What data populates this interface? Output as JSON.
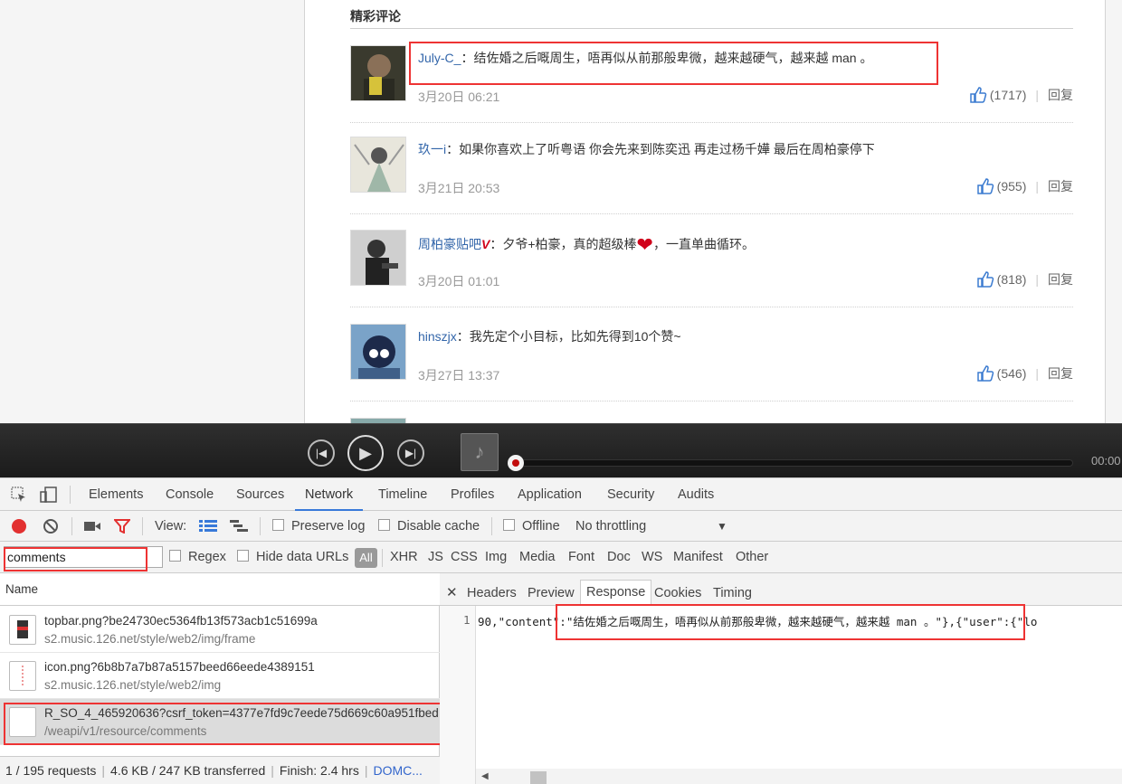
{
  "page": {
    "section_title": "精彩评论",
    "comments": [
      {
        "user": "July-C_",
        "text": "：结佐婚之后嘅周生，唔再似从前那般卑微，越来越硬气，越来越 man 。",
        "time": "3月20日 06:21",
        "likes": "(1717)",
        "reply": "回复"
      },
      {
        "user": "玖一i",
        "text": "：如果你喜欢上了听粤语 你会先来到陈奕迅 再走过杨千嬅 最后在周柏豪停下",
        "time": "3月21日 20:53",
        "likes": "(955)",
        "reply": "回复"
      },
      {
        "user": "周柏豪贴吧",
        "badge": "V",
        "text_before": "：夕爷+柏豪，真的超级棒",
        "heart": "❤",
        "text_after": "，一直单曲循环。",
        "time": "3月20日 01:01",
        "likes": "(818)",
        "reply": "回复"
      },
      {
        "user": "hinszjx",
        "text": "：我先定个小目标，比如先得到10个赞~",
        "time": "3月27日 13:37",
        "likes": "(546)",
        "reply": "回复"
      }
    ]
  },
  "player": {
    "time": "00:00",
    "progress": 0
  },
  "devtools": {
    "tabs": [
      "Elements",
      "Console",
      "Sources",
      "Network",
      "Timeline",
      "Profiles",
      "Application",
      "Security",
      "Audits"
    ],
    "active_tab": "Network",
    "toolbar": {
      "view_label": "View:",
      "preserve_log": "Preserve log",
      "disable_cache": "Disable cache",
      "offline": "Offline",
      "throttling": "No throttling"
    },
    "filter": {
      "value": "comments",
      "regex": "Regex",
      "hide_data_urls": "Hide data URLs",
      "all": "All",
      "types": [
        "XHR",
        "JS",
        "CSS",
        "Img",
        "Media",
        "Font",
        "Doc",
        "WS",
        "Manifest",
        "Other"
      ]
    },
    "name_header": "Name",
    "requests": [
      {
        "name": "topbar.png?be24730ec5364fb13f573acb1c51699a",
        "path": "s2.music.126.net/style/web2/img/frame"
      },
      {
        "name": "icon.png?6b8b7a7b87a5157beed66eede4389151",
        "path": "s2.music.126.net/style/web2/img"
      },
      {
        "name": "R_SO_4_465920636?csrf_token=4377e7fd9c7eede75d669c60a951fbed",
        "path": "/weapi/v1/resource/comments"
      }
    ],
    "response_tabs": [
      "Headers",
      "Preview",
      "Response",
      "Cookies",
      "Timing"
    ],
    "active_response_tab": "Response",
    "code": {
      "line_no": "1",
      "text": "90,\"content\":\"结佐婚之后嘅周生，唔再似从前那般卑微，越来越硬气，越来越 man 。\"},{\"user\":{\"lo"
    },
    "status": {
      "requests": "1 / 195 requests",
      "transferred": "4.6 KB / 247 KB transferred",
      "finish": "Finish: 2.4 hrs",
      "domc": "DOMC..."
    }
  }
}
